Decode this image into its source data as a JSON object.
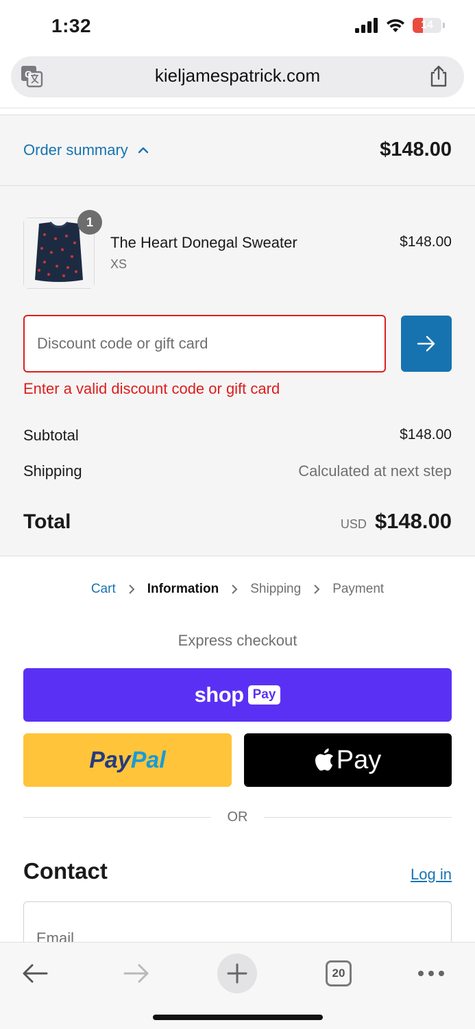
{
  "status_bar": {
    "time": "1:32",
    "battery_level": "14",
    "battery_color": "#ea4b3f"
  },
  "browser": {
    "url": "kieljamespatrick.com",
    "translate_icon": "translate-icon",
    "share_icon": "share-icon"
  },
  "order_summary": {
    "toggle_label": "Order summary",
    "toggle_icon": "chevron-up-icon",
    "total": "$148.00",
    "item": {
      "quantity": "1",
      "name": "The Heart Donegal Sweater",
      "variant": "XS",
      "price": "$148.00"
    },
    "discount": {
      "placeholder": "Discount code or gift card",
      "value": "",
      "apply_icon": "arrow-right-icon",
      "error": "Enter a valid discount code or gift card"
    },
    "subtotal_label": "Subtotal",
    "subtotal_value": "$148.00",
    "shipping_label": "Shipping",
    "shipping_value": "Calculated at next step",
    "total_label": "Total",
    "total_currency": "USD",
    "total_value": "$148.00"
  },
  "breadcrumb": {
    "items": [
      "Cart",
      "Information",
      "Shipping",
      "Payment"
    ],
    "current": "Information"
  },
  "express_checkout": {
    "title": "Express checkout",
    "shop_pay": {
      "word": "shop",
      "chip": "Pay",
      "color": "#5a31f4"
    },
    "paypal": {
      "part1": "Pay",
      "part2": "Pal",
      "color": "#ffc439"
    },
    "apple_pay": {
      "word": "Pay",
      "icon": "apple-icon",
      "color": "#000000"
    },
    "or_label": "OR"
  },
  "contact": {
    "title": "Contact",
    "login_label": "Log in",
    "email_placeholder": "Email",
    "email_value": ""
  },
  "toolbar": {
    "back_icon": "back-arrow-icon",
    "forward_icon": "forward-arrow-icon",
    "new_tab_icon": "plus-icon",
    "tab_count": "20",
    "more_icon": "more-icon"
  },
  "colors": {
    "accent": "#1773b0",
    "error": "#dd1d1d"
  }
}
